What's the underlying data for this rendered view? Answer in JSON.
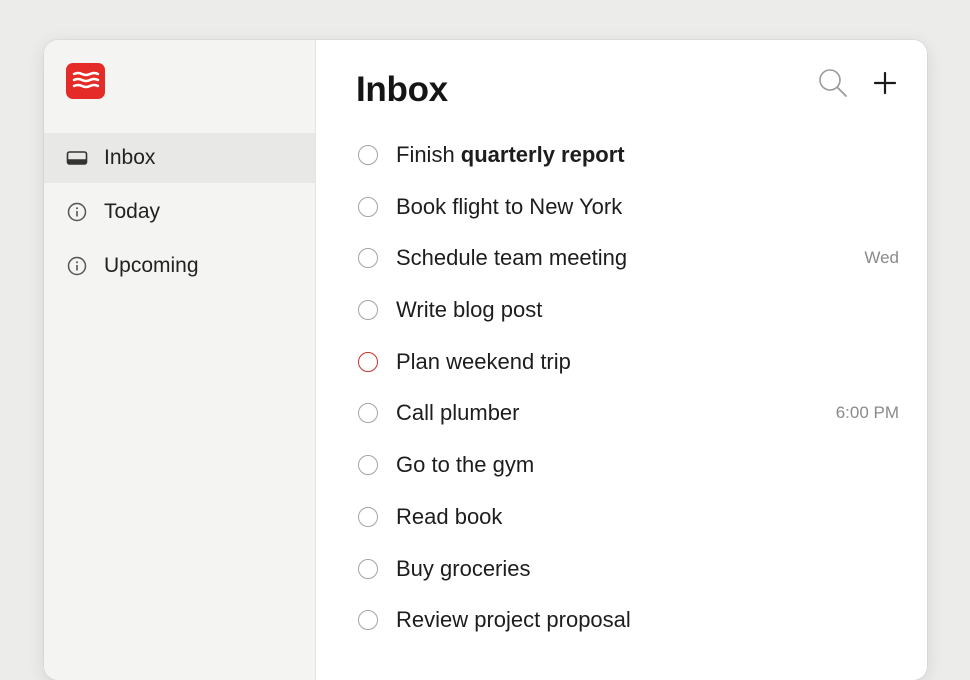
{
  "sidebar": {
    "logo": "todoist-logo",
    "items": [
      {
        "label": "Inbox",
        "icon": "inbox-icon",
        "active": true
      },
      {
        "label": "Today",
        "icon": "info-circle-icon",
        "active": false
      },
      {
        "label": "Upcoming",
        "icon": "info-circle-icon",
        "active": false
      }
    ]
  },
  "header": {
    "title": "Inbox",
    "search_icon": "search-icon",
    "add_icon": "plus-icon"
  },
  "tasks": [
    {
      "prefix": "Finish ",
      "emphasis": "quarterly report",
      "meta": "",
      "priority": false
    },
    {
      "prefix": "Book flight to New York",
      "emphasis": "",
      "meta": "",
      "priority": false
    },
    {
      "prefix": "Schedule team meeting",
      "emphasis": "",
      "meta": "Wed",
      "priority": false
    },
    {
      "prefix": "Write blog post",
      "emphasis": "",
      "meta": "",
      "priority": false
    },
    {
      "prefix": "Plan weekend trip",
      "emphasis": "",
      "meta": "",
      "priority": true
    },
    {
      "prefix": "Call plumber",
      "emphasis": "",
      "meta": "6:00 PM",
      "priority": false
    },
    {
      "prefix": "Go to the gym",
      "emphasis": "",
      "meta": "",
      "priority": false
    },
    {
      "prefix": "Read book",
      "emphasis": "",
      "meta": "",
      "priority": false
    },
    {
      "prefix": "Buy groceries",
      "emphasis": "",
      "meta": "",
      "priority": false
    },
    {
      "prefix": "Review project proposal",
      "emphasis": "",
      "meta": "",
      "priority": false
    }
  ],
  "colors": {
    "accent": "#e52b27",
    "priority_ring": "#c8312d",
    "sidebar_bg": "#f4f4f2",
    "active_item_bg": "#e8e8e6"
  }
}
